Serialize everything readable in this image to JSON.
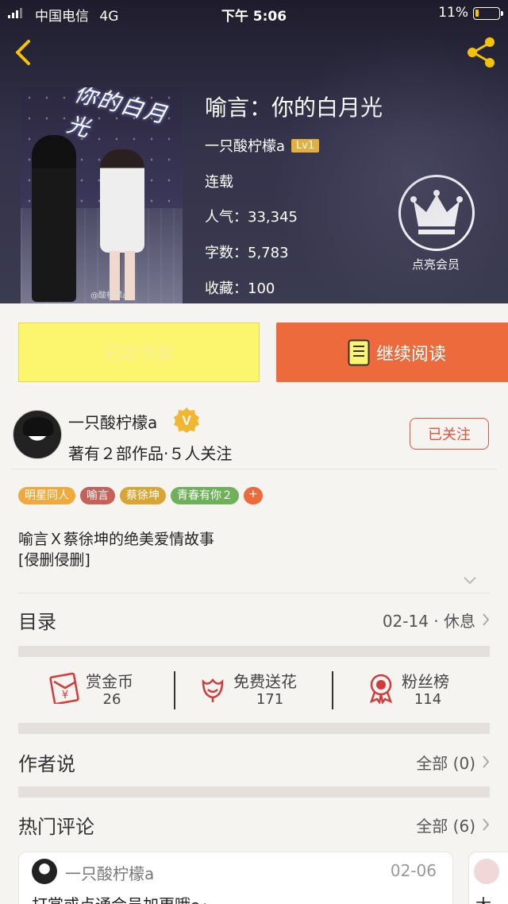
{
  "status_bar": {
    "carrier": "中国电信",
    "network": "4G",
    "time": "下午 5:06",
    "battery": "11%"
  },
  "book": {
    "cover_title": "你的白月光",
    "cover_watermark": "@酸柠檬a",
    "title": "喻言：你的白月光",
    "author": "一只酸柠檬a",
    "level": "Lv1",
    "status": "连载",
    "popularity_label": "人气：",
    "popularity": "33,345",
    "words_label": "字数：",
    "words": "5,783",
    "favorites_label": "收藏：",
    "favorites": "100"
  },
  "vip": {
    "label": "点亮会员"
  },
  "actions": {
    "shelf_label": "已在书架",
    "read_label": "继续阅读"
  },
  "author_card": {
    "name": "一只酸柠檬a",
    "stats": "著有２部作品·５人关注",
    "follow_label": "已关注"
  },
  "tags": [
    {
      "label": "明星同人",
      "color": "#f2a93b"
    },
    {
      "label": "喻言",
      "color": "#c8605a"
    },
    {
      "label": "蔡徐坤",
      "color": "#d9a434"
    },
    {
      "label": "青春有你２",
      "color": "#6fb05b"
    },
    {
      "label": "+",
      "color": "#ec6a3c"
    }
  ],
  "description": {
    "line1": "喻言Ｘ蔡徐坤的绝美爱情故事",
    "line2": "[侵删侵删]"
  },
  "toc": {
    "heading": "目录",
    "latest": "02-14 · 休息"
  },
  "stats": [
    {
      "label": "赏金币",
      "value": "26",
      "icon": "red-envelope-icon"
    },
    {
      "label": "免费送花",
      "value": "171",
      "icon": "flower-icon"
    },
    {
      "label": "粉丝榜",
      "value": "114",
      "icon": "medal-icon"
    }
  ],
  "author_says": {
    "heading": "作者说",
    "link": "全部 (0)"
  },
  "comments": {
    "heading": "热门评论",
    "link": "全部 (6)",
    "items": [
      {
        "user": "一只酸柠檬a",
        "date": "02-06",
        "text": "打赏或点通会员加更哦～"
      },
      {
        "text": "大"
      }
    ]
  },
  "colors": {
    "accent": "#ec6a3c",
    "shelf_yellow": "#fcf56e",
    "level_gold": "#e8b33a",
    "follow_red": "#e0543e"
  }
}
